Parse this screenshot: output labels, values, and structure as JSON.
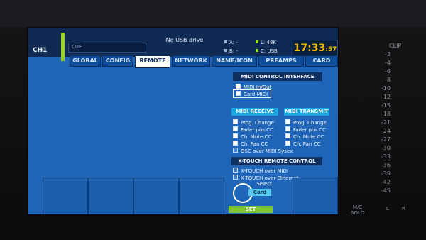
{
  "header": {
    "channel": "CH1",
    "cue_label": "CUE",
    "usb_status": "No USB drive",
    "slot_a": "A:",
    "slot_a_val": "-",
    "slot_b": "B:",
    "slot_b_val": "-",
    "slot_l": "L:",
    "slot_l_val": "48K",
    "slot_c": "C:",
    "slot_c_val": "USB",
    "time_hm": "17:33",
    "time_s": ":57"
  },
  "tabs": [
    "GLOBAL",
    "CONFIG",
    "REMOTE",
    "NETWORK",
    "NAME/ICON",
    "PREAMPS",
    "CARD"
  ],
  "active_tab": "REMOTE",
  "midi_control": {
    "title": "MIDI CONTROL INTERFACE",
    "options": [
      "MIDI In/Out",
      "Card MIDI"
    ],
    "selected": "Card MIDI"
  },
  "midi_receive": {
    "title": "MIDI RECEIVE",
    "options": [
      "Prog. Change",
      "Fader pos CC",
      "Ch. Mute CC",
      "Ch. Pan CC",
      "OSC over MIDI Sysex"
    ]
  },
  "midi_transmit": {
    "title": "MIDI TRANSMIT",
    "options": [
      "Prog. Change",
      "Fader pos CC",
      "Ch. Mute CC",
      "Ch. Pan CC"
    ]
  },
  "xtouch": {
    "title": "X-TOUCH REMOTE CONTROL",
    "options": [
      "X-TOUCH over MIDI",
      "X-TOUCH over Ethernet"
    ]
  },
  "knob": {
    "label": "Select",
    "value": "Card",
    "button": "SET"
  },
  "meter": {
    "clip": "CLIP",
    "ticks": [
      "-2",
      "-4",
      "-6",
      "-8",
      "-10",
      "-12",
      "-15",
      "-18",
      "-21",
      "-24",
      "-27",
      "-30",
      "-33",
      "-36",
      "-39",
      "-42",
      "-45"
    ],
    "mc": "M/C",
    "solo": "SOLO",
    "l": "L",
    "r": "R"
  }
}
